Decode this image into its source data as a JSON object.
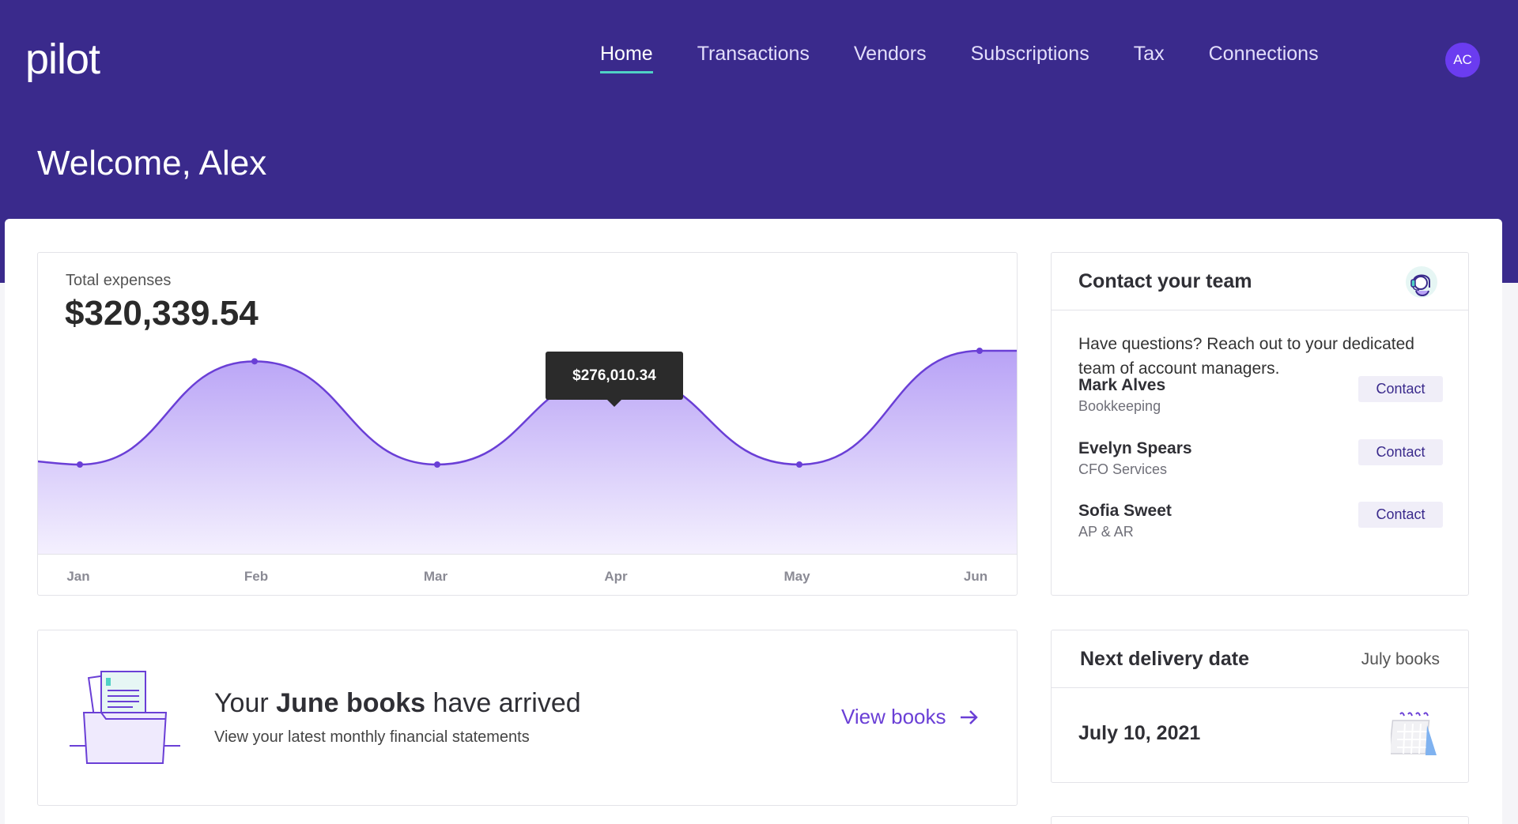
{
  "app": {
    "logo": "pilot"
  },
  "nav": {
    "items": [
      {
        "label": "Home",
        "active": true
      },
      {
        "label": "Transactions"
      },
      {
        "label": "Vendors"
      },
      {
        "label": "Subscriptions"
      },
      {
        "label": "Tax"
      },
      {
        "label": "Connections"
      }
    ]
  },
  "user": {
    "initials": "AC"
  },
  "welcome": "Welcome, Alex",
  "expenses": {
    "label": "Total expenses",
    "total": "$320,339.54",
    "tooltip": "$276,010.34"
  },
  "chart_data": {
    "type": "area",
    "categories": [
      "Jan",
      "Feb",
      "Mar",
      "Apr",
      "May",
      "Jun"
    ],
    "values": [
      60000,
      305000,
      60000,
      276010.34,
      60000,
      330000
    ],
    "highlight_index": 3,
    "colors": {
      "line": "#6a3fd6",
      "fill_top": "#b8a2f6",
      "fill_bottom": "#f4f0fe"
    }
  },
  "contact": {
    "title": "Contact your team",
    "icon": "support-agent-icon",
    "description": "Have questions? Reach out to your dedicated team of account managers.",
    "people": [
      {
        "name": "Mark Alves",
        "role": "Bookkeeping",
        "button": "Contact"
      },
      {
        "name": "Evelyn Spears",
        "role": "CFO Services",
        "button": "Contact"
      },
      {
        "name": "Sofia Sweet",
        "role": "AP & AR",
        "button": "Contact"
      }
    ]
  },
  "books": {
    "title_prefix": "Your ",
    "title_bold": "June books",
    "title_suffix": " have arrived",
    "subtitle": "View your latest monthly financial statements",
    "link": "View books",
    "icon": "books-folder-icon"
  },
  "delivery": {
    "title": "Next delivery date",
    "period": "July books",
    "date": "July 10, 2021",
    "icon": "calendar-icon"
  },
  "colors": {
    "header": "#3a2a8c",
    "accent": "#6a3fd6",
    "nav_underline": "#4fd1c5",
    "avatar": "#6b3cf0"
  }
}
